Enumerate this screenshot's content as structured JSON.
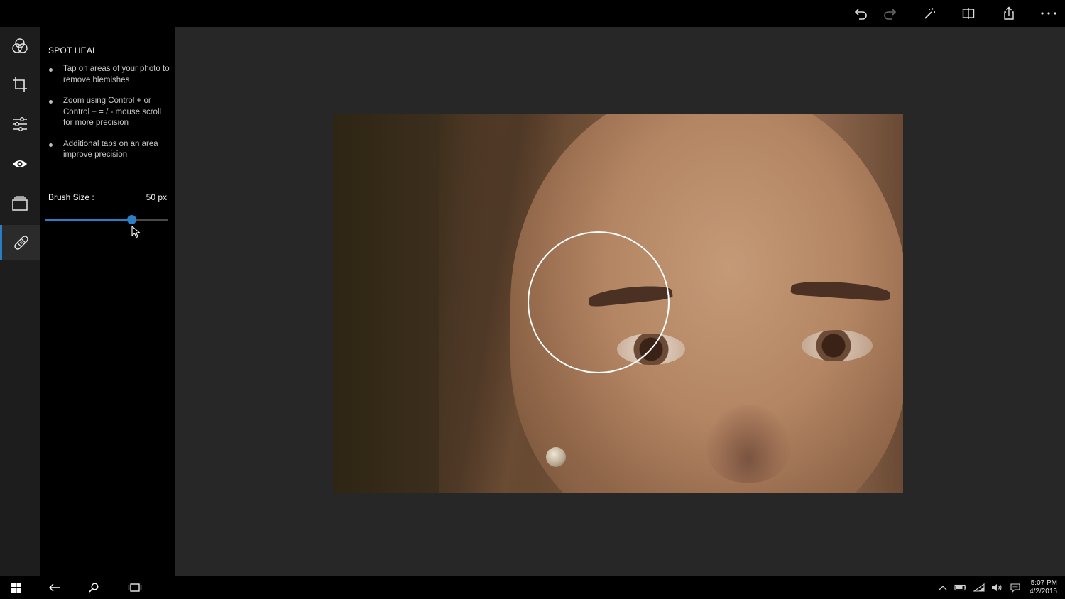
{
  "panel": {
    "title": "SPOT HEAL",
    "tips": [
      "Tap on areas of your photo to remove blemishes",
      "Zoom using Control + or Control + = / - mouse scroll for more precision",
      "Additional taps on an area improve precision"
    ],
    "brush_size_label": "Brush Size :",
    "brush_size_value": "50 px",
    "brush_slider_fraction": 0.7
  },
  "toolbar": {
    "icons": [
      "undo-icon",
      "redo-icon",
      "auto-enhance-icon",
      "compare-icon",
      "share-icon",
      "more-icon"
    ]
  },
  "rail": {
    "icons": [
      "filters-icon",
      "crop-icon",
      "adjustments-icon",
      "red-eye-icon",
      "frames-icon",
      "spot-heal-icon"
    ],
    "active": "spot-heal-icon"
  },
  "taskbar": {
    "time": "5:07 PM",
    "date": "4/2/2015"
  },
  "colors": {
    "accent": "#2a7fc4",
    "panel_bg": "#000000",
    "canvas_bg": "#272727"
  }
}
